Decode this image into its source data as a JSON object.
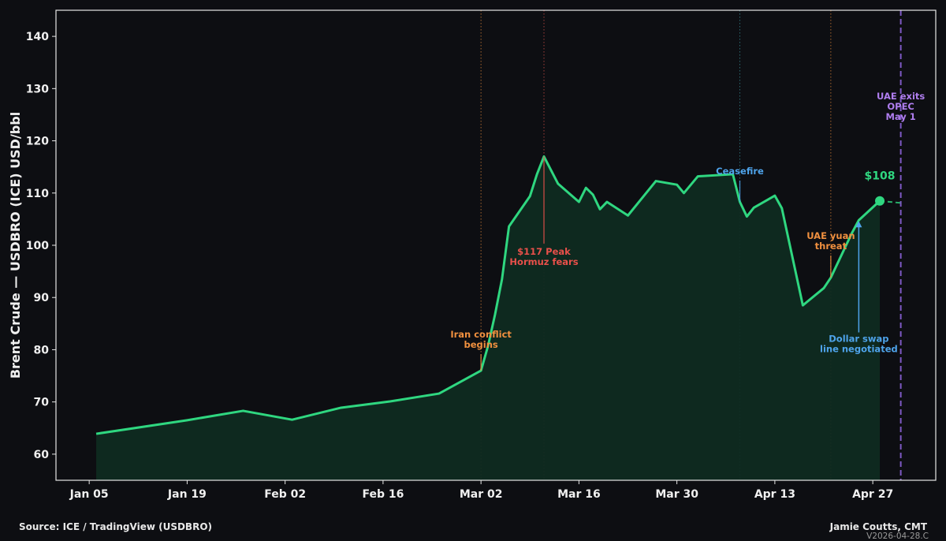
{
  "chart_data": {
    "type": "area",
    "xlabel": "",
    "ylabel": "Brent Crude — USDBRO (ICE) USD/bbl",
    "xlim": [
      "2025-12-31",
      "2026-05-06"
    ],
    "ylim": [
      55,
      145
    ],
    "grid": false,
    "x_ticks": [
      {
        "date": "2026-01-05",
        "label": "Jan 05"
      },
      {
        "date": "2026-01-19",
        "label": "Jan 19"
      },
      {
        "date": "2026-02-02",
        "label": "Feb 02"
      },
      {
        "date": "2026-02-16",
        "label": "Feb 16"
      },
      {
        "date": "2026-03-02",
        "label": "Mar 02"
      },
      {
        "date": "2026-03-16",
        "label": "Mar 16"
      },
      {
        "date": "2026-03-30",
        "label": "Mar 30"
      },
      {
        "date": "2026-04-13",
        "label": "Apr 13"
      },
      {
        "date": "2026-04-27",
        "label": "Apr 27"
      }
    ],
    "y_ticks": [
      60,
      70,
      80,
      90,
      100,
      110,
      120,
      130,
      140
    ],
    "series": [
      {
        "color": "#2fd780",
        "fill": "#0f2b21",
        "points": [
          [
            "2026-01-06",
            63.9
          ],
          [
            "2026-01-19",
            66.5
          ],
          [
            "2026-01-27",
            68.3
          ],
          [
            "2026-02-03",
            66.6
          ],
          [
            "2026-02-10",
            68.9
          ],
          [
            "2026-02-17",
            70.1
          ],
          [
            "2026-02-24",
            71.6
          ],
          [
            "2026-03-02",
            76.0
          ],
          [
            "2026-03-03",
            80.7
          ],
          [
            "2026-03-04",
            86.7
          ],
          [
            "2026-03-05",
            93.5
          ],
          [
            "2026-03-06",
            103.6
          ],
          [
            "2026-03-09",
            109.4
          ],
          [
            "2026-03-10",
            113.6
          ],
          [
            "2026-03-11",
            117.0
          ],
          [
            "2026-03-13",
            111.8
          ],
          [
            "2026-03-16",
            108.3
          ],
          [
            "2026-03-17",
            111.0
          ],
          [
            "2026-03-18",
            109.7
          ],
          [
            "2026-03-19",
            106.9
          ],
          [
            "2026-03-20",
            108.3
          ],
          [
            "2026-03-23",
            105.7
          ],
          [
            "2026-03-27",
            112.3
          ],
          [
            "2026-03-30",
            111.6
          ],
          [
            "2026-03-31",
            110.0
          ],
          [
            "2026-04-02",
            113.2
          ],
          [
            "2026-04-07",
            113.6
          ],
          [
            "2026-04-08",
            108.3
          ],
          [
            "2026-04-09",
            105.5
          ],
          [
            "2026-04-10",
            107.2
          ],
          [
            "2026-04-13",
            109.5
          ],
          [
            "2026-04-14",
            107.1
          ],
          [
            "2026-04-17",
            88.5
          ],
          [
            "2026-04-20",
            91.8
          ],
          [
            "2026-04-21",
            93.8
          ],
          [
            "2026-04-24",
            102.3
          ],
          [
            "2026-04-25",
            104.8
          ],
          [
            "2026-04-28",
            108.5
          ]
        ]
      }
    ],
    "projection": {
      "color": "#2fd780",
      "points": [
        [
          "2026-04-28",
          108.5
        ],
        [
          "2026-05-01",
          108.1
        ]
      ]
    },
    "last_value_label": "$108",
    "event_lines": [
      {
        "date": "2026-03-02",
        "color": "#e8893a",
        "style": "dotted"
      },
      {
        "date": "2026-03-11",
        "color": "#e0534a",
        "style": "dotted"
      },
      {
        "date": "2026-04-08",
        "color": "#3a8f9a",
        "style": "dotted"
      },
      {
        "date": "2026-04-21",
        "color": "#e8893a",
        "style": "dotted"
      },
      {
        "date": "2026-05-01",
        "color": "#8a62d8",
        "style": "dashed"
      }
    ],
    "annotations": [
      {
        "lines": [
          "Iran conflict",
          "begins"
        ],
        "color": "#f0903f",
        "date": "2026-03-02",
        "value": 76.0,
        "label_value": 82.3,
        "arrow": false
      },
      {
        "lines": [
          "$117 Peak",
          "Hormuz fears"
        ],
        "color": "#e8504a",
        "date": "2026-03-11",
        "value": 117.0,
        "label_value": 98.2,
        "arrow": false
      },
      {
        "lines": [
          "Ceasefire"
        ],
        "color": "#4ea3ea",
        "date": "2026-04-08",
        "value": 108.3,
        "label_value": 113.6,
        "arrow": false
      },
      {
        "lines": [
          "UAE yuan",
          "threat"
        ],
        "color": "#f0903f",
        "date": "2026-04-21",
        "value": 93.8,
        "label_value": 101.2,
        "arrow": false
      },
      {
        "lines": [
          "Dollar swap",
          "line negotiated"
        ],
        "color": "#4ea3ea",
        "date": "2026-04-25",
        "value": 104.8,
        "label_value": 81.5,
        "arrow": true
      },
      {
        "lines": [
          "UAE exits",
          "OPEC",
          "May 1"
        ],
        "color": "#b07ef0",
        "date": "2026-05-01",
        "value": 130,
        "label_value": 127.9,
        "arrow": false
      }
    ]
  },
  "footer": {
    "source": "Source: ICE / TradingView (USDBRO)",
    "author": "Jamie Coutts, CMT",
    "version": "V2026-04-28.C"
  }
}
